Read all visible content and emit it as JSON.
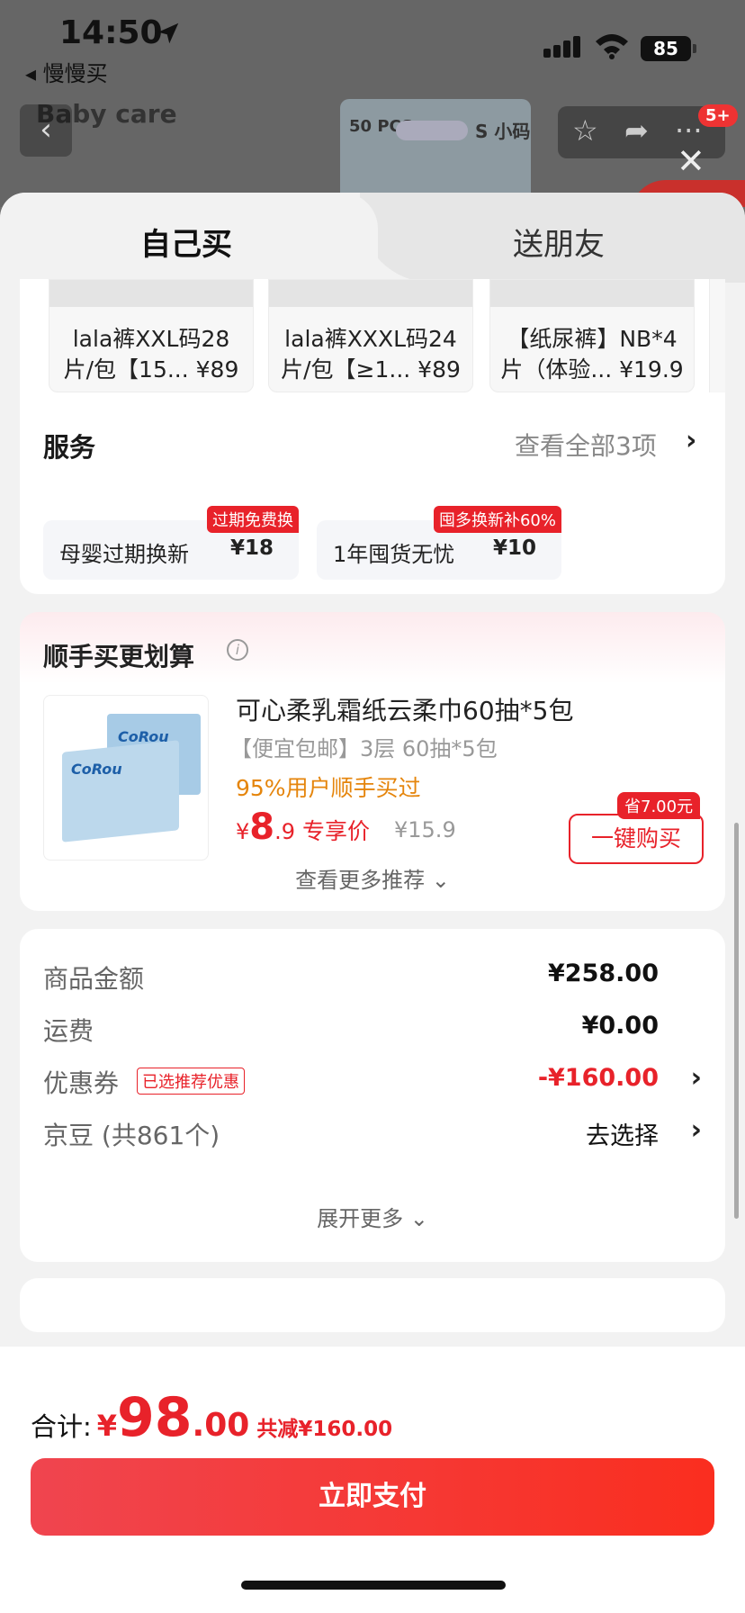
{
  "status_bar": {
    "time": "14:50",
    "back_app": "◂ 慢慢买",
    "battery": "85"
  },
  "backdrop": {
    "brand_logo": "Baby care",
    "pack_count": "50 PCS",
    "pack_size": "S 小码",
    "badge": "5+"
  },
  "tabs": {
    "self": "自己买",
    "gift": "送朋友"
  },
  "skus": [
    {
      "line1": "lala裤XXL码28",
      "line2": "片/包【15... ¥89"
    },
    {
      "line1": "lala裤XXXL码24",
      "line2": "片/包【≥1... ¥89"
    },
    {
      "line1": "【纸尿裤】NB*4",
      "line2": "片（体验... ¥19.9"
    }
  ],
  "services": {
    "title": "服务",
    "more": "查看全部3项",
    "items": [
      {
        "name": "母婴过期换新",
        "price": "¥18",
        "tag": "过期免费换"
      },
      {
        "name": "1年囤货无忧",
        "price": "¥10",
        "tag": "囤多换新补60%"
      }
    ]
  },
  "recommend": {
    "title": "顺手买更划算",
    "brand_text": "CoRou",
    "name": "可心柔乳霜纸云柔巾60抽*5包",
    "spec": "【便宜包邮】3层 60抽*5包",
    "social": "95%用户顺手买过",
    "price_cur": "¥",
    "price_int": "8",
    "price_dec": ".9",
    "price_label": "专享价",
    "orig_price": "¥15.9",
    "save_tag": "省7.00元",
    "buy_label": "一键购买",
    "more": "查看更多推荐"
  },
  "summary": {
    "goods_label": "商品金额",
    "goods_value": "¥258.00",
    "shipping_label": "运费",
    "shipping_value": "¥0.00",
    "coupon_label": "优惠券",
    "coupon_tag": "已选推荐优惠",
    "coupon_value": "-¥160.00",
    "jingdou_label": "京豆 (共861个)",
    "jingdou_value": "去选择",
    "expand": "展开更多"
  },
  "checkout": {
    "total_label": "合计:",
    "cur": "¥",
    "amount_int": "98",
    "amount_dec": ".00",
    "discount": "共减¥160.00",
    "pay_label": "立即支付"
  },
  "colors": {
    "accent": "#e8222a",
    "pay_gradient_start": "#f0454f",
    "pay_gradient_end": "#fa2e1f",
    "social_orange": "#e5850c"
  }
}
